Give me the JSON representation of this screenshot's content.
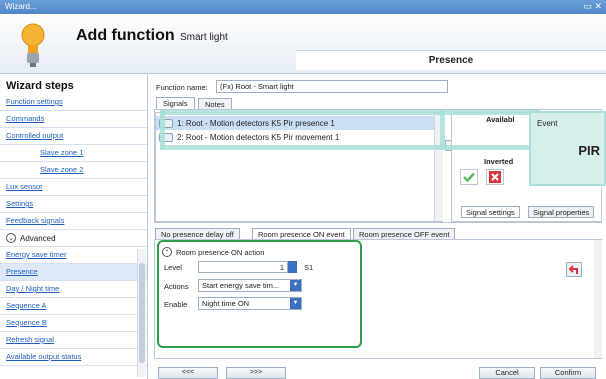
{
  "window": {
    "title": "Wizard...",
    "controls": "▭ ✕"
  },
  "header": {
    "title": "Add function",
    "subtitle": "Smart light",
    "section": "Presence"
  },
  "sidebar": {
    "title": "Wizard steps",
    "items": [
      {
        "label": "Function settings"
      },
      {
        "label": "Commands"
      },
      {
        "label": "Controlled output"
      },
      {
        "label": "Slave zone 1"
      },
      {
        "label": "Slave zone 2"
      },
      {
        "label": "Lux sensor"
      },
      {
        "label": "Settings"
      },
      {
        "label": "Feedback signals"
      }
    ],
    "advanced_label": "Advanced",
    "advanced_items": [
      {
        "label": "Energy save timer"
      },
      {
        "label": "Presence"
      },
      {
        "label": "Day / Night time"
      },
      {
        "label": "Sequence A"
      },
      {
        "label": "Sequence B"
      },
      {
        "label": "Refresh signal"
      },
      {
        "label": "Available output status"
      }
    ]
  },
  "form": {
    "function_name_label": "Function name:",
    "function_name_value": "(Fx) Root - Smart light",
    "tabs": [
      "Signals",
      "Notes"
    ],
    "signals": [
      {
        "label": "1: Root - Motion detectors K5 Pir presence 1"
      },
      {
        "label": "2: Root - Motion detectors K5 Pir movement 1"
      }
    ],
    "available_label": "Availabl",
    "inverted_label": "Inverted",
    "signal_tabs": [
      "Signal settings",
      "Signal properties"
    ],
    "event_tabs": [
      "No presence delay off",
      "Room presence ON event",
      "Room presence OFF event"
    ],
    "action_title": "Room presence ON action",
    "level_label": "Level",
    "level_value": "1",
    "level_unit": "S1",
    "actions_label": "Actions",
    "actions_value": "Start energy save tim...",
    "enable_label": "Enable",
    "enable_value": "Night time ON"
  },
  "footer": {
    "prev": "<<<",
    "next": ">>>",
    "cancel": "Cancel",
    "confirm": "Confirm"
  },
  "callout": {
    "title": "Event",
    "value": "PIR"
  },
  "colors": {
    "accent": "#3a6fc1",
    "highlight": "#2e9e4a",
    "overlay": "#a9dfd8"
  }
}
